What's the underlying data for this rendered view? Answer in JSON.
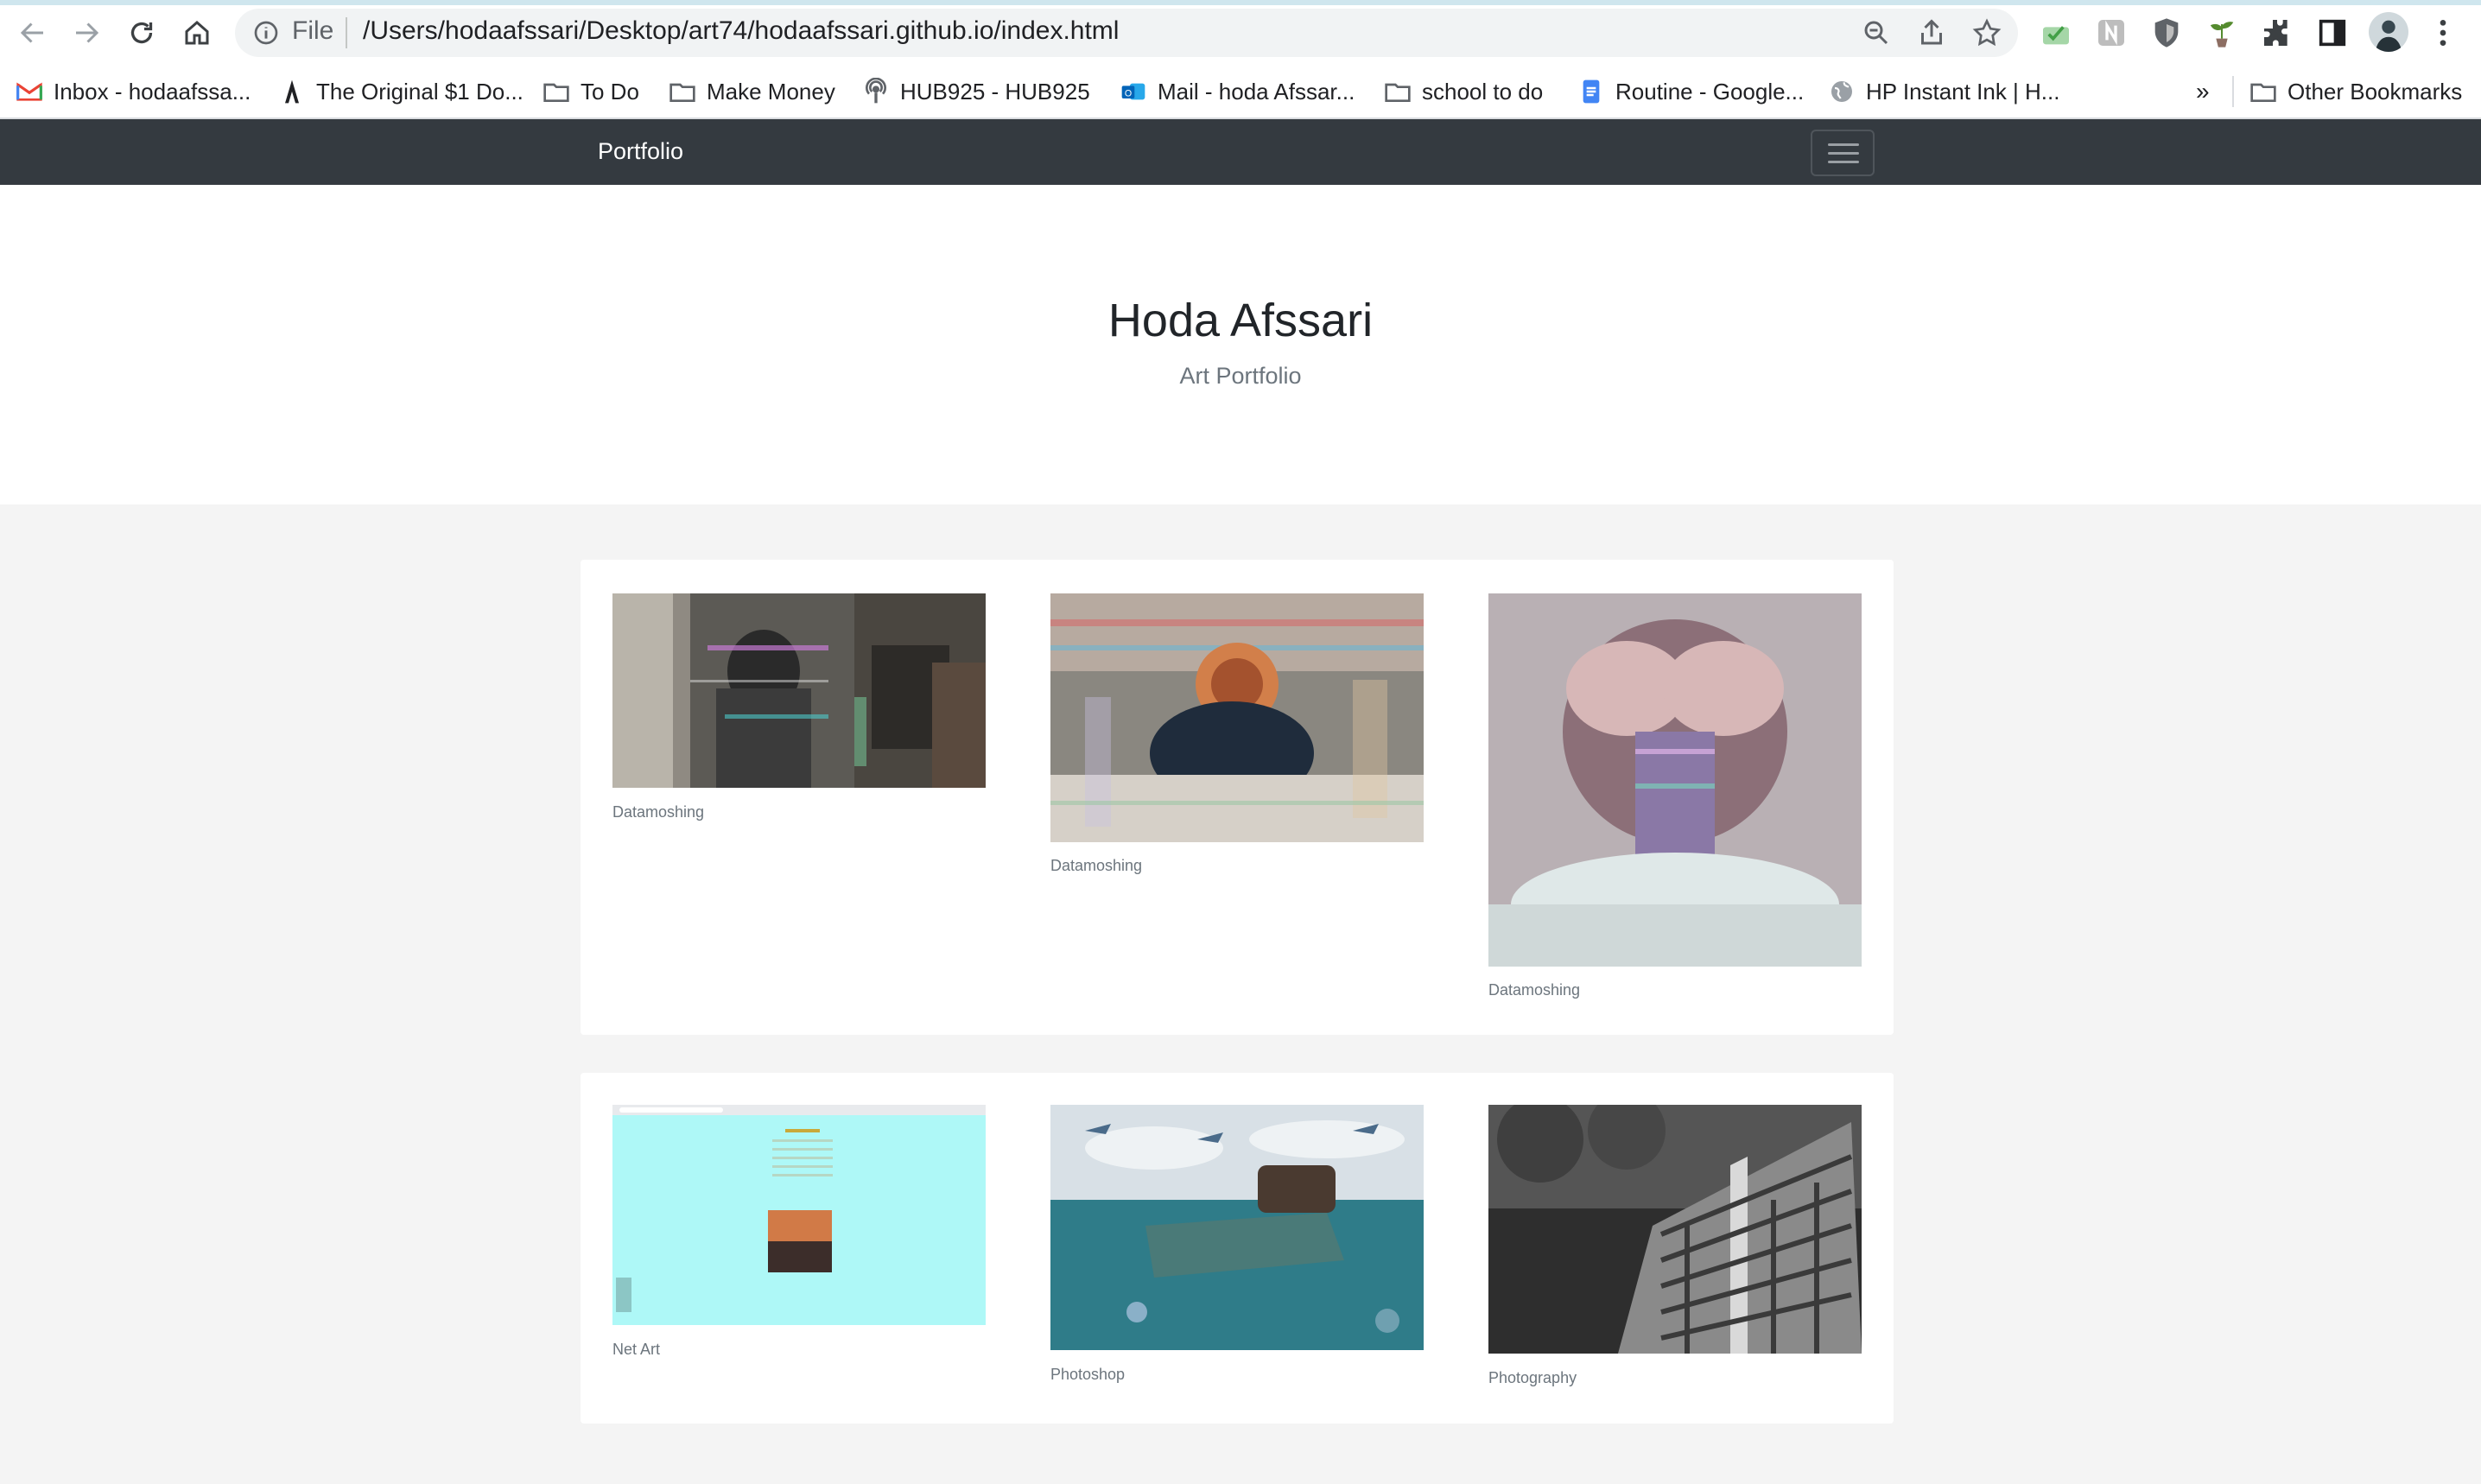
{
  "browser": {
    "address_scheme": "File",
    "url": "/Users/hodaafssari/Desktop/art74/hodaafssari.github.io/index.html",
    "bookmarks": [
      {
        "label": "Inbox - hodaafssa...",
        "icon": "gmail-icon"
      },
      {
        "label": "The Original $1 Do...",
        "icon": "razor-icon"
      },
      {
        "label": "To Do",
        "icon": "folder-icon"
      },
      {
        "label": "Make Money",
        "icon": "folder-icon"
      },
      {
        "label": "HUB925 - HUB925",
        "icon": "podcast-icon"
      },
      {
        "label": "Mail - hoda Afssar...",
        "icon": "outlook-icon"
      },
      {
        "label": "school to do",
        "icon": "folder-icon"
      },
      {
        "label": "Routine - Google...",
        "icon": "docs-icon"
      },
      {
        "label": "HP Instant Ink | H...",
        "icon": "globe-icon"
      }
    ],
    "overflow_label": "»",
    "other_bookmarks": "Other Bookmarks"
  },
  "site": {
    "brand": "Portfolio",
    "title": "Hoda Afssari",
    "subtitle": "Art Portfolio"
  },
  "gallery": [
    {
      "caption": "Datamoshing",
      "image": "glitched photo of person in room"
    },
    {
      "caption": "Datamoshing",
      "image": "glitched photo of person at desk"
    },
    {
      "caption": "Datamoshing",
      "image": "glitched portrait hands over face"
    },
    {
      "caption": "Net Art",
      "image": "cyan web page screenshot"
    },
    {
      "caption": "Photoshop",
      "image": "sneaker boat with fish in sea"
    },
    {
      "caption": "Photography",
      "image": "black and white apartment building"
    }
  ],
  "colors": {
    "navbar": "#343a40",
    "page_bg": "#f4f4f4",
    "net_art_bg": "#aef8f7"
  }
}
